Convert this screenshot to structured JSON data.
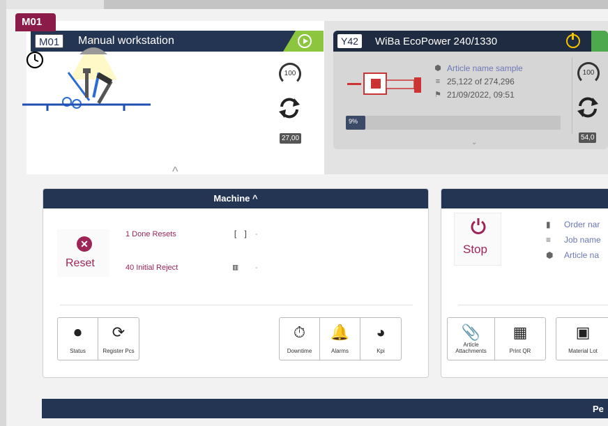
{
  "station": {
    "badge": "M01",
    "code": "M01",
    "title": "Manual workstation",
    "gauge_value": "100",
    "cycle_value": "27,00"
  },
  "machine_card": {
    "code": "Y42",
    "title": "WiBa EcoPower 240/1330",
    "article_name": "Article name sample",
    "count": "25,122 of 274,296",
    "date": "21/09/2022, 09:51",
    "progress_label": "9%",
    "progress_fraction": 0.09,
    "gauge_value": "100",
    "cycle_value": "54,0"
  },
  "machine_panel": {
    "title": "Machine ^",
    "reset_label": "Reset",
    "done_resets": "1 Done Resets",
    "initial_reject": "40 Initial Reject",
    "dash1": "-",
    "dash2": "-",
    "buttons": {
      "status": "Status",
      "register_pcs": "Register Pcs",
      "downtime": "Downtime",
      "alarms": "Alarms",
      "kpi": "Kpi"
    }
  },
  "order_panel": {
    "stop_label": "Stop",
    "order_name": "Order nar",
    "job_name": "Job name",
    "article_name": "Article na",
    "buttons": {
      "article_attachments": "Article Attachments",
      "print_qr": "Print QR",
      "material_lot": "Material Lot"
    }
  },
  "performance_bar": {
    "label": "Pe"
  },
  "colors": {
    "navy": "#243554",
    "accent_red": "#9d2457",
    "green": "#8cc63f",
    "link": "#6c77b8"
  }
}
